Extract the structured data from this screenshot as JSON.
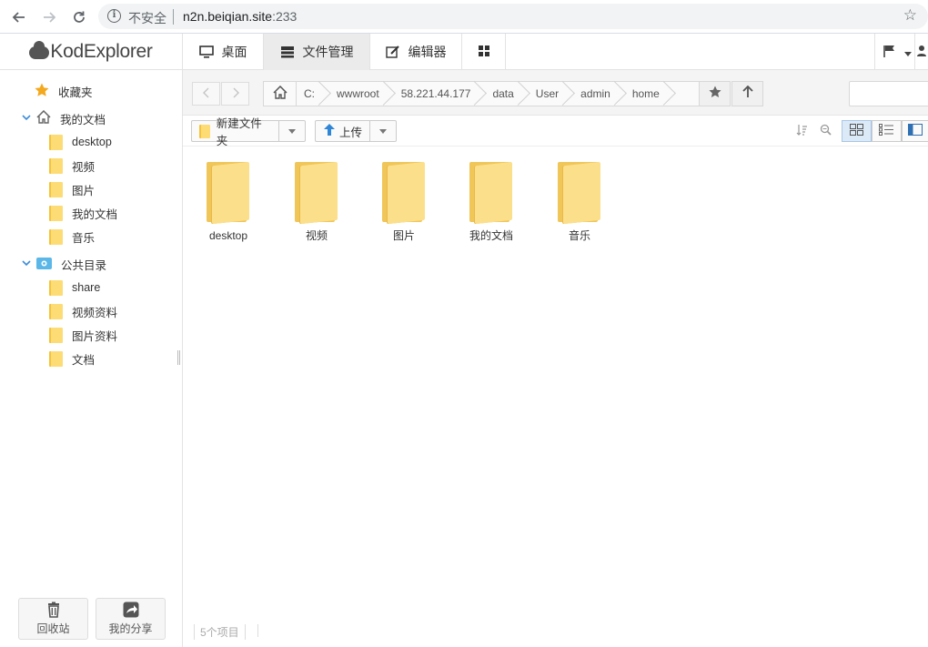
{
  "browser": {
    "insecure_label": "不安全",
    "url_host": "n2n.beiqian.site",
    "url_port": ":233"
  },
  "app": {
    "logo_text": "KodExplorer",
    "tabs": [
      {
        "label": "桌面",
        "icon": "monitor-icon"
      },
      {
        "label": "文件管理",
        "icon": "file-manager-icon"
      },
      {
        "label": "编辑器",
        "icon": "edit-icon"
      },
      {
        "label": "",
        "icon": "grid-icon"
      }
    ]
  },
  "sidebar": {
    "favorites": "收藏夹",
    "my_docs": "我的文档",
    "my_docs_children": [
      "desktop",
      "视频",
      "图片",
      "我的文档",
      "音乐"
    ],
    "public": "公共目录",
    "public_children": [
      "share",
      "视频资料",
      "图片资料",
      "文档"
    ],
    "recycle": "回收站",
    "my_share": "我的分享"
  },
  "pathbar": {
    "crumbs": [
      "C:",
      "wwwroot",
      "58.221.44.177",
      "data",
      "User",
      "admin",
      "home"
    ]
  },
  "toolbar": {
    "new_folder": "新建文件夹",
    "upload": "上传"
  },
  "files": [
    "desktop",
    "视频",
    "图片",
    "我的文档",
    "音乐"
  ],
  "status": {
    "count": "5个项目"
  },
  "colors": {
    "folder": "#fcdf8a",
    "folder_dark": "#f0c659",
    "accent_blue": "#3b8cd9",
    "active_tab": "#ebebeb"
  }
}
